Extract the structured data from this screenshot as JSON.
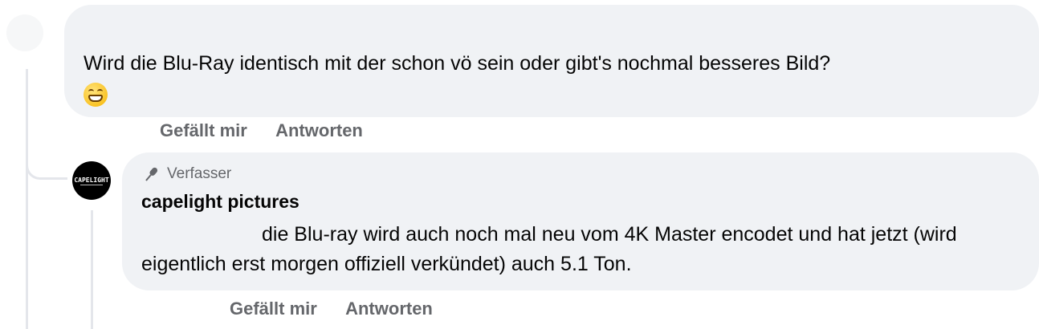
{
  "comment": {
    "text": "Wird die Blu-Ray identisch mit der schon vö sein oder gibt's nochmal besseres Bild?",
    "emoji": "grinning-face-with-smiling-eyes",
    "actions": {
      "like": "Gefällt mir",
      "reply": "Antworten"
    }
  },
  "reply": {
    "badge": "Verfasser",
    "badge_icon": "microphone-icon",
    "author": "capelight pictures",
    "avatar_text": "CAPELIGHT",
    "text": "die Blu-ray wird auch noch mal neu vom 4K Master encodet und hat jetzt (wird eigentlich erst morgen offiziell verkündet) auch 5.1 Ton.",
    "actions": {
      "like": "Gefällt mir",
      "reply": "Antworten"
    }
  },
  "colors": {
    "bubble": "#f0f2f5",
    "secondary_text": "#65676b",
    "thread_line": "#e4e6eb"
  }
}
